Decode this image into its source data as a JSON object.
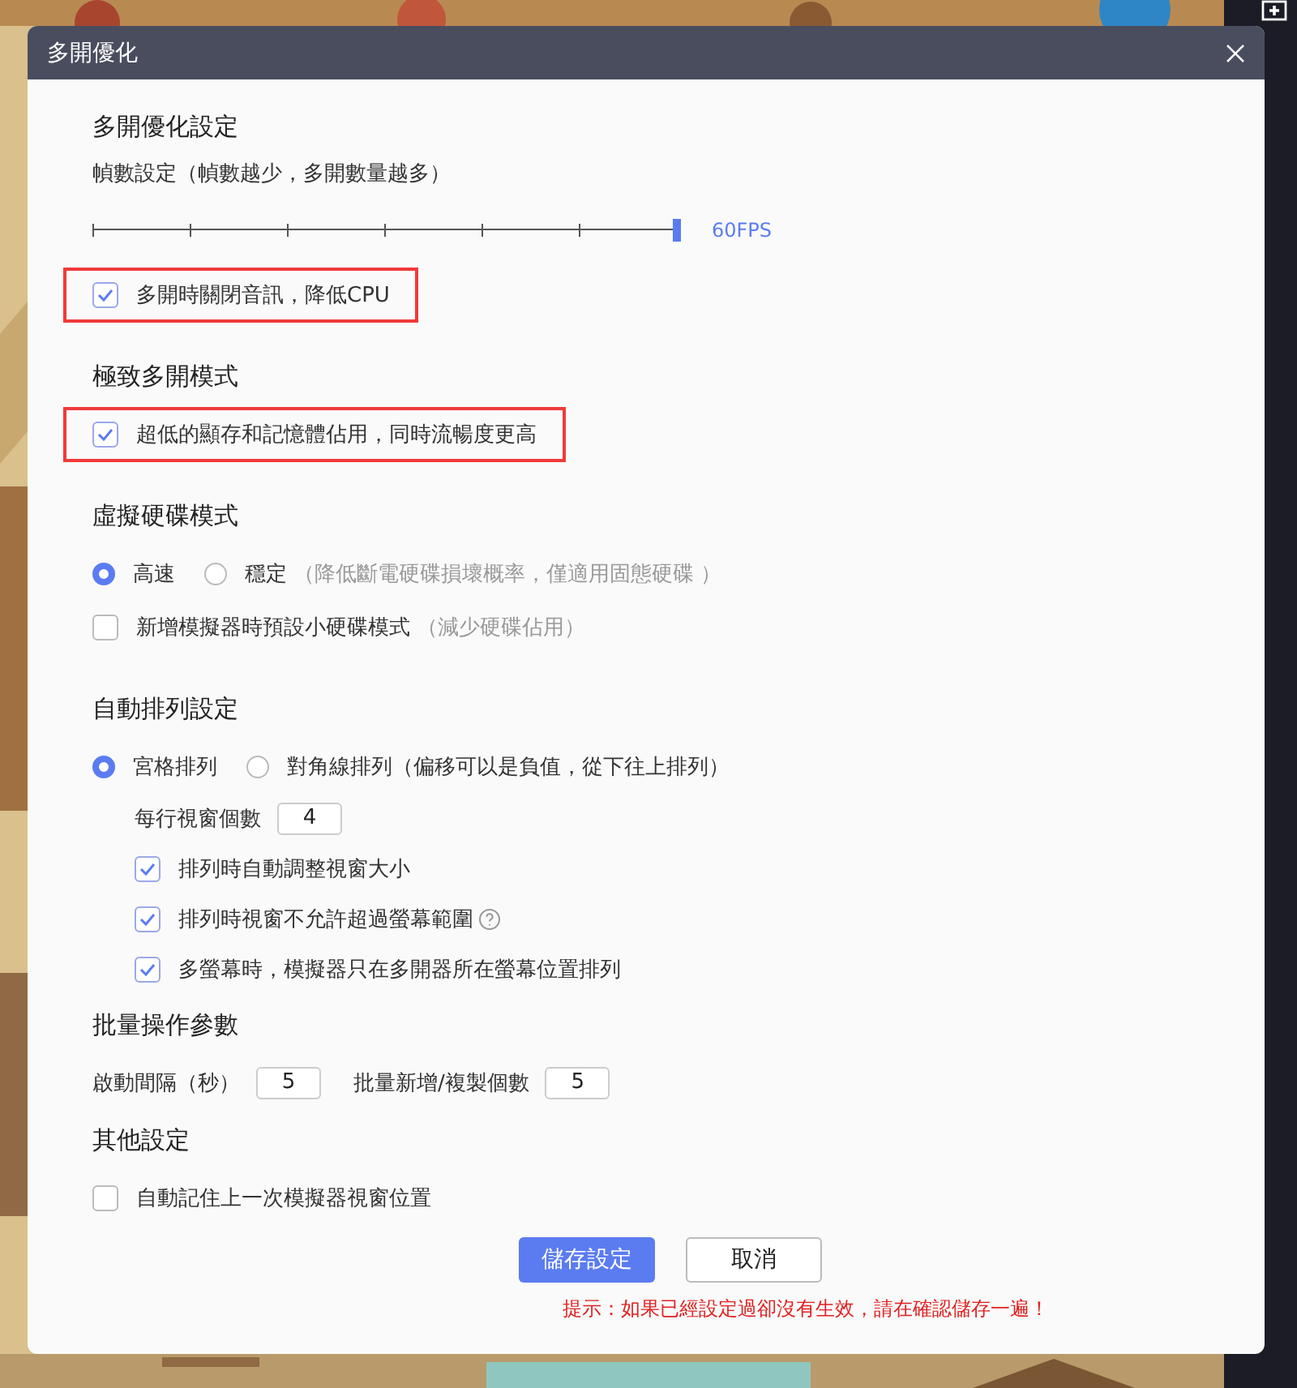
{
  "dialog": {
    "title": "多開優化"
  },
  "sections": [
    {
      "heading": "多開優化設定",
      "items": [
        {
          "kind": "slider",
          "label": "幀數設定（幀數越少，多開數量越多）",
          "level": 1,
          "reading": "60FPS"
        },
        {
          "kind": "checkbox",
          "label": "多開時關閉音訊，降低CPU",
          "checked": true,
          "highlighted": true
        }
      ]
    },
    {
      "heading": "極致多開模式",
      "items": [
        {
          "kind": "checkbox",
          "label": "超低的顯存和記憶體佔用，同時流暢度更高",
          "checked": true,
          "highlighted": true
        }
      ]
    },
    {
      "heading": "虛擬硬碟模式",
      "items": [
        {
          "kind": "radios",
          "options": [
            {
              "label": "高速",
              "selected": true
            },
            {
              "label": "穩定",
              "note": "（降低斷電硬碟損壞概率，僅適用固態硬碟 ）",
              "selected": false
            }
          ]
        },
        {
          "kind": "checkbox",
          "label": "新增模擬器時預設小硬碟模式",
          "note": "（減少硬碟佔用）",
          "checked": false
        }
      ]
    },
    {
      "heading": "自動排列設定",
      "items": [
        {
          "kind": "radios",
          "options": [
            {
              "label": "宮格排列",
              "selected": true
            },
            {
              "label": "對角線排列（偏移可以是負值，從下往上排列）",
              "selected": false
            }
          ],
          "children": [
            {
              "kind": "fields",
              "fields": [
                {
                  "label": "每行視窗個數",
                  "value": "4"
                }
              ]
            },
            {
              "kind": "checkbox",
              "label": "排列時自動調整視窗大小",
              "checked": true
            },
            {
              "kind": "checkbox",
              "label": "排列時視窗不允許超過螢幕範圍",
              "checked": true,
              "help": true
            },
            {
              "kind": "checkbox",
              "label": "多螢幕時，模擬器只在多開器所在螢幕位置排列",
              "checked": true
            }
          ]
        }
      ]
    },
    {
      "heading": "批量操作參數",
      "items": [
        {
          "kind": "fields",
          "fields": [
            {
              "label": "啟動間隔（秒）",
              "value": "5"
            },
            {
              "label": "批量新增/複製個數",
              "value": "5"
            }
          ]
        }
      ]
    },
    {
      "heading": "其他設定",
      "items": [
        {
          "kind": "checkbox",
          "label": "自動記住上一次模擬器視窗位置",
          "checked": false
        }
      ]
    }
  ],
  "buttons": [
    {
      "label": "儲存設定",
      "kind": "primary"
    },
    {
      "label": "取消",
      "kind": "default"
    }
  ],
  "hint": "提示：如果已經設定過卻沒有生效，請在確認儲存一遍！"
}
